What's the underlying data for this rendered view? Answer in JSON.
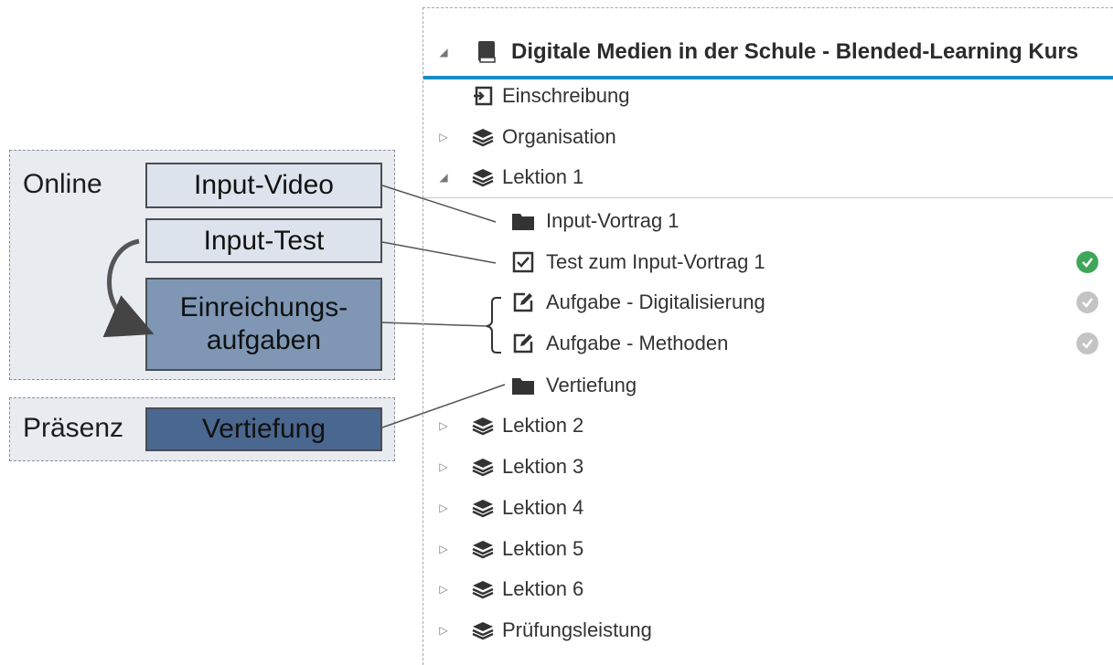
{
  "diagram": {
    "online_label": "Online",
    "praesenz_label": "Präsenz",
    "boxes": {
      "input_video": "Input-Video",
      "input_test": "Input-Test",
      "einreichung_1": "Einreichungs-",
      "einreichung_2": "aufgaben",
      "vertiefung": "Vertiefung"
    }
  },
  "tree": {
    "course_title": "Digitale Medien in der Schule - Blended-Learning Kurs",
    "items": [
      {
        "label": "Einschreibung",
        "icon": "enrol-icon"
      },
      {
        "label": "Organisation",
        "icon": "layers-icon"
      },
      {
        "label": "Lektion 1",
        "icon": "layers-icon"
      },
      {
        "label": "Input-Vortrag 1",
        "icon": "folder-icon"
      },
      {
        "label": "Test zum Input-Vortrag 1",
        "icon": "checkbox-icon",
        "status": "done"
      },
      {
        "label": "Aufgabe - Digitalisierung",
        "icon": "edit-icon",
        "status": "open"
      },
      {
        "label": "Aufgabe - Methoden",
        "icon": "edit-icon",
        "status": "open"
      },
      {
        "label": "Vertiefung",
        "icon": "folder-icon"
      },
      {
        "label": "Lektion 2",
        "icon": "layers-icon"
      },
      {
        "label": "Lektion 3",
        "icon": "layers-icon"
      },
      {
        "label": "Lektion 4",
        "icon": "layers-icon"
      },
      {
        "label": "Lektion 5",
        "icon": "layers-icon"
      },
      {
        "label": "Lektion 6",
        "icon": "layers-icon"
      },
      {
        "label": "Prüfungsleistung",
        "icon": "layers-icon"
      }
    ]
  },
  "colors": {
    "accent": "#1a8cc6",
    "status_done": "#3fa55a",
    "status_open": "#c4c4c4",
    "box_light": "#dde3ec",
    "box_mid": "#7f97b5",
    "box_dark": "#4a678f"
  }
}
